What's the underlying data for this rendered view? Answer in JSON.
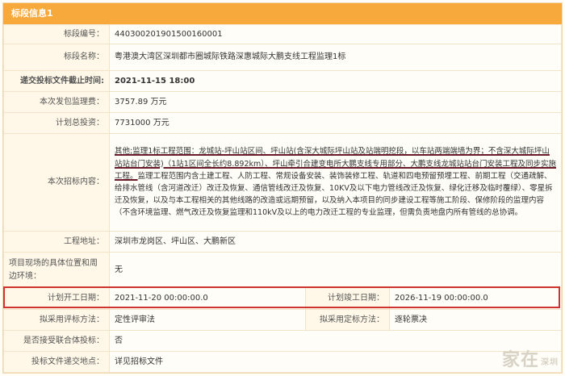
{
  "header": {
    "title": "标段信息1"
  },
  "rows": {
    "code": {
      "label": "标段编号：",
      "value": "440300201901500160001"
    },
    "name": {
      "label": "标段名称：",
      "value": "粤港澳大湾区深圳都市圈城际铁路深惠城际大鹏支线工程监理1标"
    },
    "deadline": {
      "label": "递交投标文件截止时间:",
      "value": "2021-11-15 18:00"
    },
    "fee": {
      "label": "本次发包监理费：",
      "value": "3757.89 万元"
    },
    "invest": {
      "label": "计划总投资：",
      "value": "7731000 万元"
    },
    "scope": {
      "label": "本次招标内容：",
      "u1": "其他;监理1标工程范围：龙城站-坪山站区间、坪山站(含深大城际坪山站及站端明挖段，以车站两端端墙为界；不含深大城际坪山站站台门安装)（1站1区间全长约8.892km）、坪山牵引合建变电所大鹏支线专用部分、大鹏支线龙城站站台门安装工程及同步实施工程。",
      "rest": "监理工程范围内含土建工程、人防工程、常规设备安装、装饰装修工程、轨道和四电预留预埋工程、前期工程（交通疏解、给排水管线（含河道改迁）改迁及恢复、通信管线改迁及恢复、10KV及以下电力管线改迁及恢复、绿化迁移及临时覆绿）、零星拆迁及恢复，以及与本工程相关的其他线路的改造或远期预留，以及纳入本项目的同步建设工程等施工阶段、保修阶段的监理内容（不含环境监理、燃气改迁及恢复监理和110kV及以上的电力改迁工程的专业监理，但需负责地盘内所有管线的总协调。"
    },
    "location": {
      "label": "工程地址：",
      "value": "深圳市龙岗区、坪山区、大鹏新区"
    },
    "site": {
      "label": "项目现场的具体位置和周边环境：",
      "value": "无"
    },
    "dates": {
      "start_label": "计划开工日期：",
      "start_value": "2021-11-20 00:00:00.0",
      "end_label": "计划竣工日期：",
      "end_value": "2026-11-19 00:00:00.0"
    },
    "eval": {
      "method_label": "拟采用评标方法：",
      "method_value": "定性评审法",
      "award_label": "拟采用定标方法：",
      "award_value": "逐轮票决"
    },
    "consortium": {
      "label": "是否接受联合体投标：",
      "value": "否"
    },
    "submit": {
      "label": "投标文件递交地点：",
      "value": "详见招标文件"
    }
  },
  "watermark": {
    "text": "家在",
    "sub": "深圳"
  },
  "colors": {
    "header_bg": "#f8a93c",
    "highlight_red": "#e02020",
    "box_red": "#d0322e"
  }
}
